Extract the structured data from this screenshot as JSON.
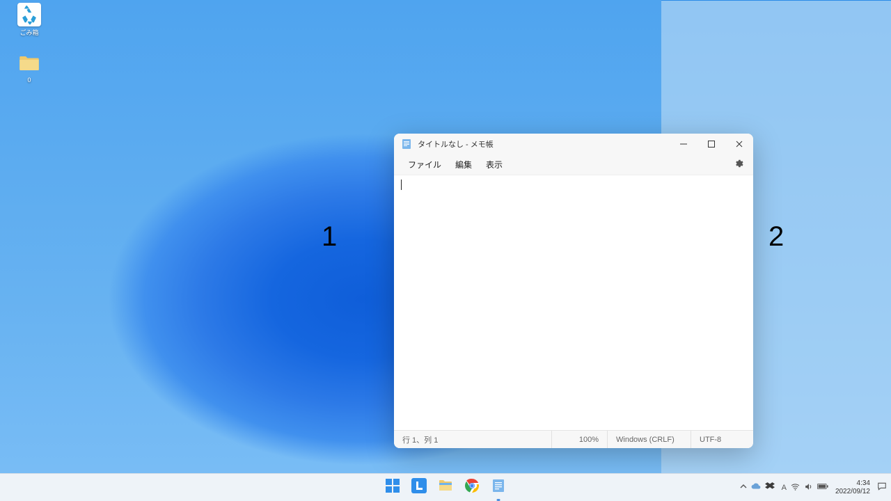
{
  "desktop": {
    "icons": {
      "recycle_label": "ごみ箱",
      "folder_label": "0"
    },
    "zones": {
      "left_label": "1",
      "right_label": "2"
    }
  },
  "notepad": {
    "title": "タイトルなし - メモ帳",
    "menu": {
      "file": "ファイル",
      "edit": "編集",
      "view": "表示"
    },
    "editor_content": "",
    "status": {
      "position": "行 1、列 1",
      "zoom": "100%",
      "eol": "Windows (CRLF)",
      "encoding": "UTF-8"
    }
  },
  "taskbar": {
    "tray": {
      "time": "4:34",
      "date": "2022/09/12"
    }
  }
}
